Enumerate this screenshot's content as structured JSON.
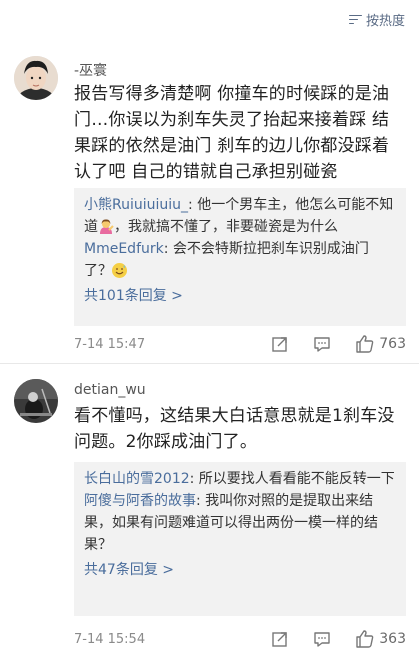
{
  "sort": {
    "label": "按热度"
  },
  "comments": [
    {
      "username": "-巫寰",
      "body": "报告写得多清楚啊 你撞车的时候踩的是油门…你误以为刹车失灵了抬起来接着踩 结果踩的依然是油门 刹车的边儿你都没踩着 认了吧 自己的错就自己承担别碰瓷",
      "replies": [
        {
          "user": "小熊Ruiuiuiuiu_",
          "text_a": ": 他一个男车主，他怎么可能不知道",
          "text_b": "，我就搞不懂了，非要碰瓷是为什么"
        },
        {
          "user": "MmeEdfurk",
          "text_a": ": 会不会特斯拉把刹车识别成油门了？",
          "text_b": ""
        }
      ],
      "more_replies": "共101条回复 >",
      "time": "7-14 15:47",
      "likes": "763"
    },
    {
      "username": "detian_wu",
      "body": "看不懂吗，这结果大白话意思就是1刹车没问题。2你踩成油门了。",
      "replies": [
        {
          "user": "长白山的雪2012",
          "text_a": ": 所以要找人看看能不能反转一下",
          "text_b": ""
        },
        {
          "user": "阿傻与阿香的故事",
          "text_a": ": 我叫你对照的是提取出来结果，如果有问题难道可以得出两份一模一样的结果？",
          "text_b": ""
        }
      ],
      "more_replies": "共47条回复 >",
      "time": "7-14 15:54",
      "likes": "363"
    }
  ],
  "icons": {
    "sort": "sort-lines-icon",
    "repost": "repost-icon",
    "comment": "comment-icon",
    "like": "thumbs-up-icon",
    "emoji_1": "woman-tipping-hand-emoji",
    "emoji_2": "sweat-smile-emoji"
  },
  "colors": {
    "link": "#4a6d9c",
    "reply_bg": "#f2f2f2",
    "meta": "#8a8a8a"
  }
}
